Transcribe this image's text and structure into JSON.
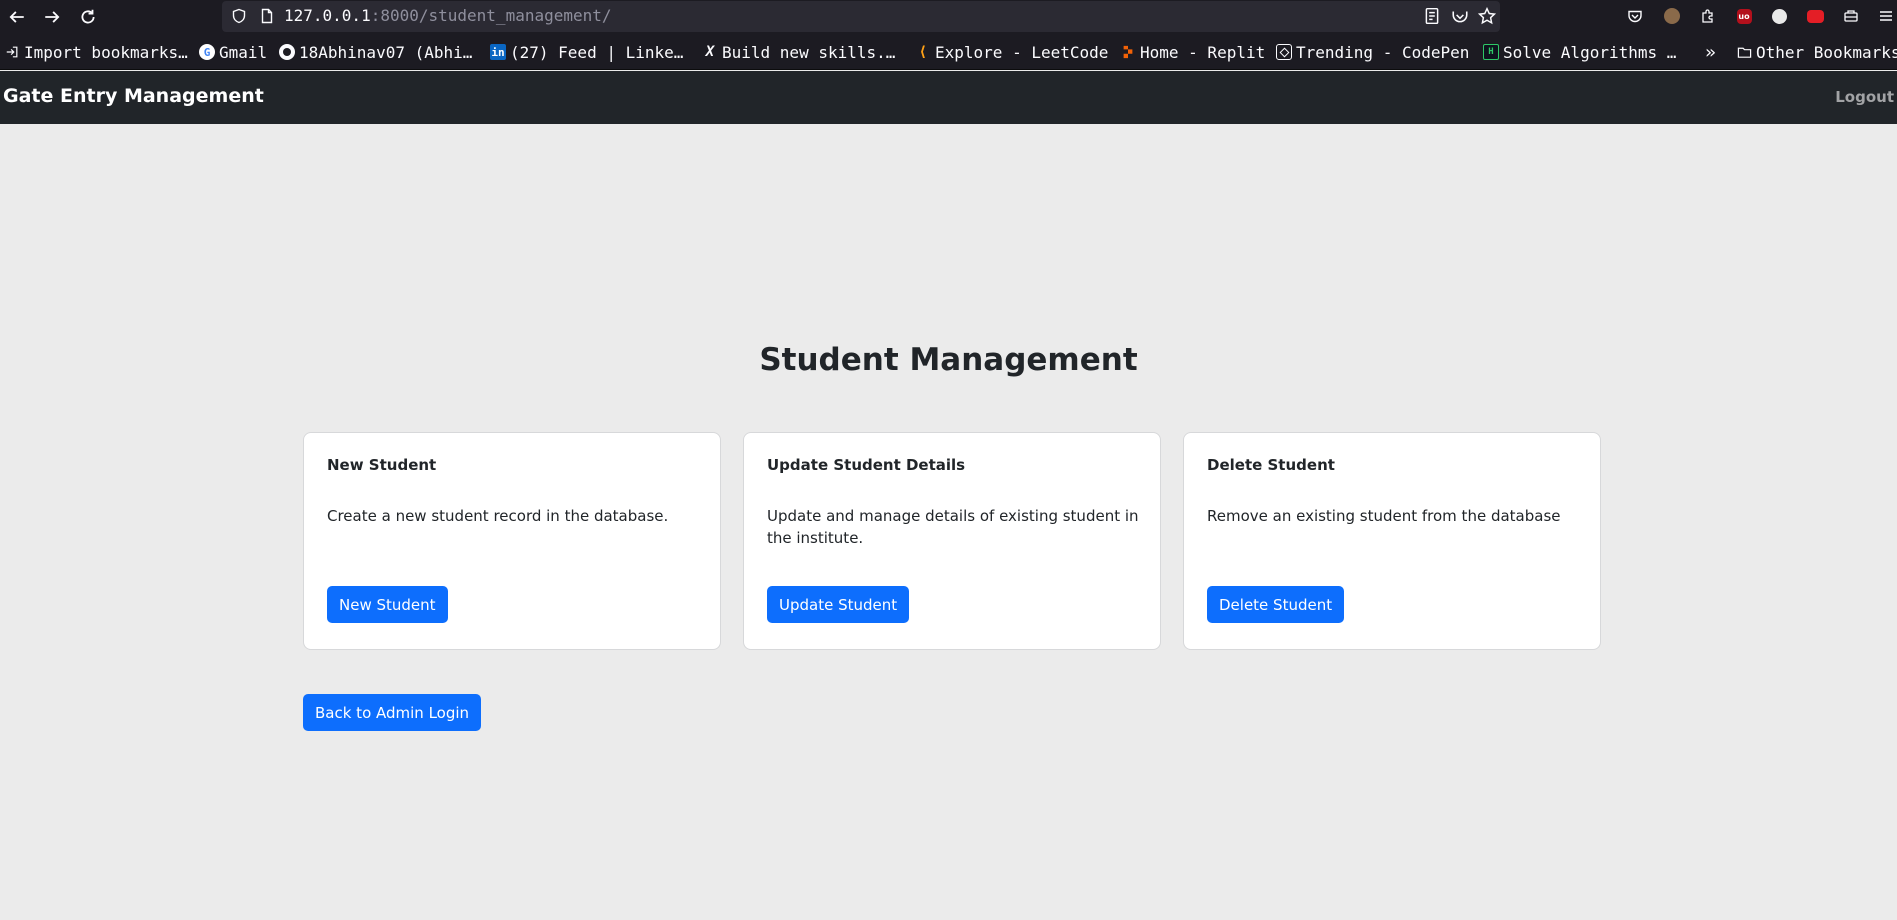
{
  "browser": {
    "url_host": "127.0.0.1",
    "url_rest": ":8000/student_management/",
    "icons": [
      "back-arrow-icon",
      "forward-arrow-icon",
      "reload-icon",
      "shield-icon",
      "page-icon",
      "reader-mode-icon",
      "pocket-icon",
      "bookmark-star-icon"
    ]
  },
  "bookmarks": [
    {
      "label": "Import bookmarks…",
      "icon": "import-icon"
    },
    {
      "label": "Gmail",
      "icon": "google-icon"
    },
    {
      "label": "18Abhinav07 (Abhi…",
      "icon": "github-icon"
    },
    {
      "label": "(27) Feed | Linke…",
      "icon": "linkedin-icon"
    },
    {
      "label": "Build new skills.…",
      "icon": "x-icon"
    },
    {
      "label": "Explore - LeetCode",
      "icon": "leetcode-icon"
    },
    {
      "label": "Home - Replit",
      "icon": "replit-icon"
    },
    {
      "label": "Trending - CodePen",
      "icon": "codepen-icon"
    },
    {
      "label": "Solve Algorithms …",
      "icon": "hackerrank-icon"
    },
    {
      "label": "Other Bookmarks",
      "icon": "folder-icon"
    }
  ],
  "navbar": {
    "brand": "Gate Entry Management",
    "logout": "Logout"
  },
  "main": {
    "title": "Student Management",
    "cards": [
      {
        "title": "New Student",
        "text": "Create a new student record in the database.",
        "button": "New Student"
      },
      {
        "title": "Update Student Details",
        "text": "Update and manage details of existing student in the institute.",
        "button": "Update Student"
      },
      {
        "title": "Delete Student",
        "text": "Remove an existing student from the database",
        "button": "Delete Student"
      }
    ],
    "back_button": "Back to Admin Login"
  },
  "colors": {
    "primary": "#0d6efd",
    "navbar_bg": "#212529",
    "page_bg": "#ebebeb"
  }
}
